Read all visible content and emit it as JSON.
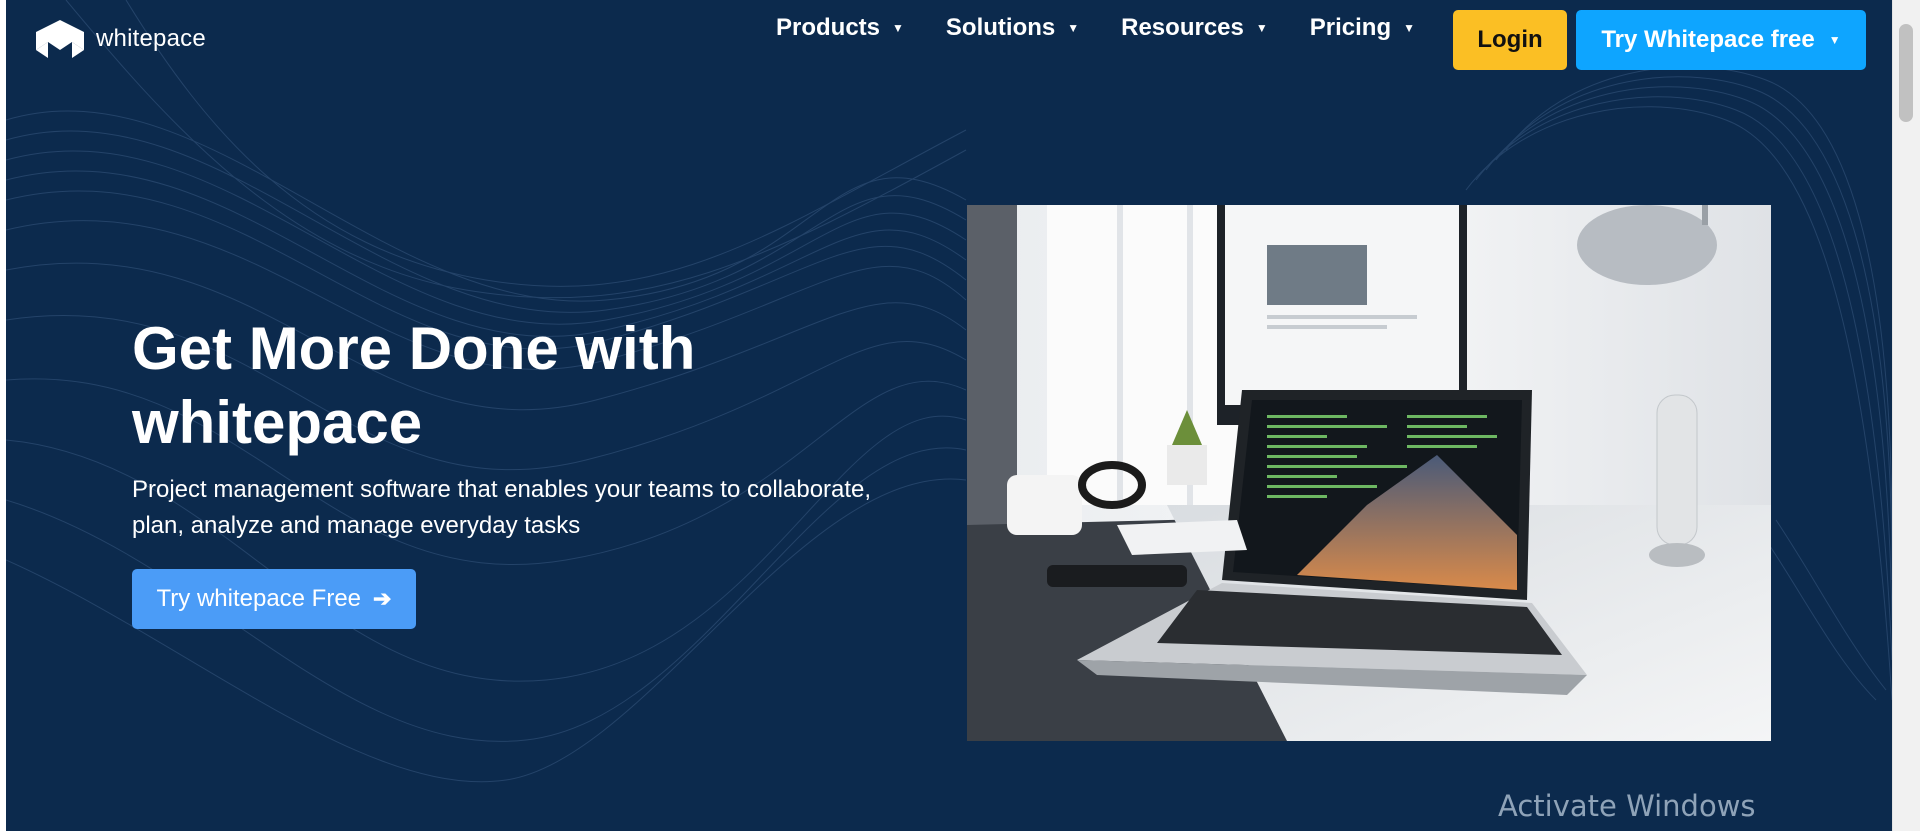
{
  "header": {
    "logo_text": "whitepace",
    "logo_icon": "whitepace-chevron-logo",
    "nav": [
      {
        "label": "Products",
        "icon": "caret-down"
      },
      {
        "label": "Solutions",
        "icon": "caret-down"
      },
      {
        "label": "Resources",
        "icon": "caret-down"
      },
      {
        "label": "Pricing",
        "icon": "caret-down"
      }
    ],
    "login_label": "Login",
    "try_label": "Try Whitepace free",
    "caret": "▼"
  },
  "hero": {
    "title_line1": "Get More Done with",
    "title_line2": "whitepace",
    "subtitle_line1": "Project management software that enables your teams to collaborate,",
    "subtitle_line2": "plan, analyze and manage everyday tasks",
    "cta_label": "Try whitepace Free",
    "cta_icon": "arrow-right",
    "image": "laptop-on-desk-photo"
  },
  "overlay": {
    "watermark": "Activate Windows"
  },
  "colors": {
    "background": "#0c2a4d",
    "login_button": "#fbbf24",
    "try_button": "#0ea5ff",
    "cta_button": "#4b9cf7"
  }
}
